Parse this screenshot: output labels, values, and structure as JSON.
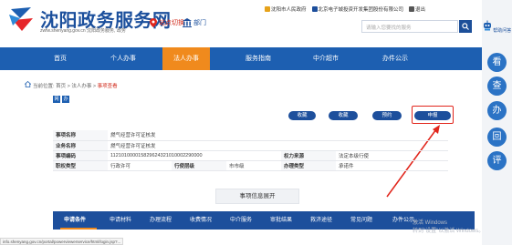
{
  "header": {
    "site_title": "沈阳政务服务网",
    "site_subtitle": "zwfw.shenyang.gov.cn  沈阳政务服务, 政务",
    "location_label": "站点切换",
    "dept_label": "部门",
    "top_links": [
      "沈阳市人民政府",
      "北京电子城投资开发集团股份有限公司",
      "退出"
    ],
    "search_placeholder": "请输入您要找的服务",
    "help_label": "帮助问答"
  },
  "nav": {
    "items": [
      "首页",
      "个人办事",
      "法人办事",
      "服务指南",
      "中介超市",
      "办件公示"
    ],
    "active_index": 2
  },
  "breadcrumb": {
    "prefix": "当前位置:",
    "path": "首页 > 法人办事 > ",
    "current": "事项查看"
  },
  "tags": [
    "网",
    "办"
  ],
  "actions": {
    "buttons": [
      "收藏",
      "收藏",
      "预约",
      "申报"
    ]
  },
  "info_table": {
    "rows": [
      [
        "事项名称",
        "燃气经营许可证核发",
        "",
        "",
        "",
        ""
      ],
      [
        "业务名称",
        "燃气经营许可证核发",
        "",
        "",
        "",
        ""
      ],
      [
        "事项编码",
        "112101000015829624321010002290000",
        "",
        "",
        "权力来源",
        "法定本级行使"
      ],
      [
        "职权类型",
        "行政许可",
        "行使层级",
        "市市级",
        "办理类型",
        "承诺件"
      ]
    ]
  },
  "more_button": "事项信息展开",
  "tabs": [
    "申请条件",
    "申请材料",
    "办理流程",
    "收费情况",
    "中介服务",
    "审批结果",
    "救济途径",
    "常见问题",
    "办件公示"
  ],
  "sidebar_buttons": [
    "看",
    "查",
    "办",
    "回",
    "评"
  ],
  "status_url": "info.shenyang.gov.cn/portal/powerviewerservice/html/login.jsp?...",
  "watermark": [
    "激活 Windows",
    "转到\"设置\"以激活 Windows。"
  ]
}
